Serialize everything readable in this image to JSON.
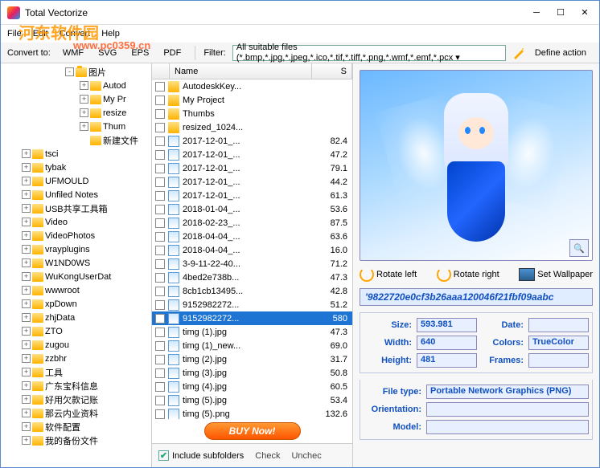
{
  "window": {
    "title": "Total Vectorize"
  },
  "watermark": {
    "brand": "河东软件园",
    "url": "www.pc0359.cn"
  },
  "menu": {
    "file": "File",
    "edit": "Edit",
    "convert": "Convert",
    "help": "Help"
  },
  "toolbar": {
    "convert_to": "Convert to:",
    "fmt_wmf": "WMF",
    "fmt_svg": "SVG",
    "fmt_eps": "EPS",
    "fmt_pdf": "PDF",
    "filter_label": "Filter:",
    "filter_value": "All suitable files (*.bmp,*.jpg,*.jpeg,*.ico,*.tif,*.tiff,*.png,*.wmf,*.emf,*.pcx ▾",
    "define_action": "Define action"
  },
  "tree": [
    {
      "pad": 78,
      "exp": "-",
      "label": "图片",
      "open": true
    },
    {
      "pad": 96,
      "exp": "+",
      "label": "Autod"
    },
    {
      "pad": 96,
      "exp": "+",
      "label": "My Pr"
    },
    {
      "pad": 96,
      "exp": "+",
      "label": "resize"
    },
    {
      "pad": 96,
      "exp": "+",
      "label": "Thum"
    },
    {
      "pad": 96,
      "exp": "",
      "label": "新建文件"
    },
    {
      "pad": 24,
      "exp": "+",
      "label": "tsci"
    },
    {
      "pad": 24,
      "exp": "+",
      "label": "tybak"
    },
    {
      "pad": 24,
      "exp": "+",
      "label": "UFMOULD"
    },
    {
      "pad": 24,
      "exp": "+",
      "label": "Unfiled Notes"
    },
    {
      "pad": 24,
      "exp": "+",
      "label": "USB共享工具箱"
    },
    {
      "pad": 24,
      "exp": "+",
      "label": "Video"
    },
    {
      "pad": 24,
      "exp": "+",
      "label": "VideoPhotos"
    },
    {
      "pad": 24,
      "exp": "+",
      "label": "vrayplugins"
    },
    {
      "pad": 24,
      "exp": "+",
      "label": "W1ND0WS"
    },
    {
      "pad": 24,
      "exp": "+",
      "label": "WuKongUserDat"
    },
    {
      "pad": 24,
      "exp": "+",
      "label": "wwwroot"
    },
    {
      "pad": 24,
      "exp": "+",
      "label": "xpDown"
    },
    {
      "pad": 24,
      "exp": "+",
      "label": "zhjData"
    },
    {
      "pad": 24,
      "exp": "+",
      "label": "ZTO"
    },
    {
      "pad": 24,
      "exp": "+",
      "label": "zugou"
    },
    {
      "pad": 24,
      "exp": "+",
      "label": "zzbhr"
    },
    {
      "pad": 24,
      "exp": "+",
      "label": "工具"
    },
    {
      "pad": 24,
      "exp": "+",
      "label": "广东宝科信息"
    },
    {
      "pad": 24,
      "exp": "+",
      "label": "好用欠款记账"
    },
    {
      "pad": 24,
      "exp": "+",
      "label": "那云内业资料"
    },
    {
      "pad": 24,
      "exp": "+",
      "label": "软件配置"
    },
    {
      "pad": 24,
      "exp": "+",
      "label": "我的备份文件"
    }
  ],
  "list": {
    "col_name": "Name",
    "col_s": "S",
    "rows": [
      {
        "type": "fold",
        "name": "AutodeskKey...",
        "size": ""
      },
      {
        "type": "fold",
        "name": "My Project",
        "size": ""
      },
      {
        "type": "fold",
        "name": "Thumbs",
        "size": ""
      },
      {
        "type": "fold",
        "name": "resized_1024...",
        "size": ""
      },
      {
        "type": "img",
        "name": "2017-12-01_...",
        "size": "82.4"
      },
      {
        "type": "img",
        "name": "2017-12-01_...",
        "size": "47.2"
      },
      {
        "type": "img",
        "name": "2017-12-01_...",
        "size": "79.1"
      },
      {
        "type": "img",
        "name": "2017-12-01_...",
        "size": "44.2"
      },
      {
        "type": "img",
        "name": "2017-12-01_...",
        "size": "61.3"
      },
      {
        "type": "img",
        "name": "2018-01-04_...",
        "size": "53.6"
      },
      {
        "type": "img",
        "name": "2018-02-23_...",
        "size": "87.5"
      },
      {
        "type": "img",
        "name": "2018-04-04_...",
        "size": "63.6"
      },
      {
        "type": "img",
        "name": "2018-04-04_...",
        "size": "16.0"
      },
      {
        "type": "img",
        "name": "3-9-11-22-40...",
        "size": "71.2"
      },
      {
        "type": "img",
        "name": "4bed2e738b...",
        "size": "47.3"
      },
      {
        "type": "img",
        "name": "8cb1cb13495...",
        "size": "42.8"
      },
      {
        "type": "img",
        "name": "9152982272...",
        "size": "51.2"
      },
      {
        "type": "img",
        "name": "9152982272...",
        "size": "580",
        "sel": true
      },
      {
        "type": "img",
        "name": "timg (1).jpg",
        "size": "47.3"
      },
      {
        "type": "img",
        "name": "timg (1)_new...",
        "size": "69.0"
      },
      {
        "type": "img",
        "name": "timg (2).jpg",
        "size": "31.7"
      },
      {
        "type": "img",
        "name": "timg (3).jpg",
        "size": "50.8"
      },
      {
        "type": "img",
        "name": "timg (4).jpg",
        "size": "60.5"
      },
      {
        "type": "img",
        "name": "timg (5).jpg",
        "size": "53.4"
      },
      {
        "type": "img",
        "name": "timg (5).png",
        "size": "132.6"
      }
    ],
    "buy": "BUY Now!"
  },
  "bottom": {
    "include": "Include subfolders",
    "check": "Check",
    "uncheck": "Unchec"
  },
  "actions": {
    "rotate_left": "Rotate left",
    "rotate_right": "Rotate right",
    "wallpaper": "Set Wallpaper"
  },
  "hash": "'9822720e0cf3b26aaa120046f21fbf09aabc",
  "props": {
    "size_l": "Size:",
    "size_v": "593.981",
    "date_l": "Date:",
    "date_v": "",
    "width_l": "Width:",
    "width_v": "640",
    "colors_l": "Colors:",
    "colors_v": "TrueColor",
    "height_l": "Height:",
    "height_v": "481",
    "frames_l": "Frames:",
    "frames_v": "",
    "filetype_l": "File type:",
    "filetype_v": "Portable Network Graphics (PNG)",
    "orient_l": "Orientation:",
    "orient_v": "",
    "model_l": "Model:",
    "model_v": ""
  }
}
